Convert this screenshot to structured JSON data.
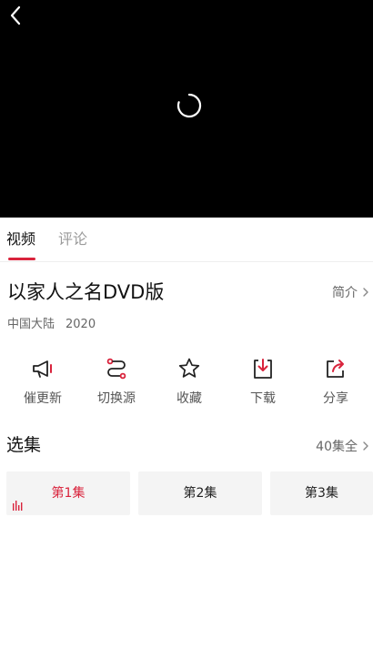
{
  "tabs": {
    "video": "视频",
    "comments": "评论"
  },
  "show": {
    "title": "以家人之名DVD版",
    "intro_label": "简介",
    "region": "中国大陆",
    "year": "2020"
  },
  "actions": [
    {
      "label": "催更新",
      "icon": "megaphone-icon"
    },
    {
      "label": "切换源",
      "icon": "switch-source-icon"
    },
    {
      "label": "收藏",
      "icon": "star-icon"
    },
    {
      "label": "下载",
      "icon": "download-icon"
    },
    {
      "label": "分享",
      "icon": "share-icon"
    }
  ],
  "episodes": {
    "title": "选集",
    "all_label": "40集全",
    "items": [
      {
        "label": "第1集",
        "active": true
      },
      {
        "label": "第2集",
        "active": false
      },
      {
        "label": "第3集",
        "active": false
      }
    ]
  },
  "colors": {
    "accent": "#d9233c",
    "player_bg": "#000000",
    "episode_bg": "#f4f4f4"
  }
}
